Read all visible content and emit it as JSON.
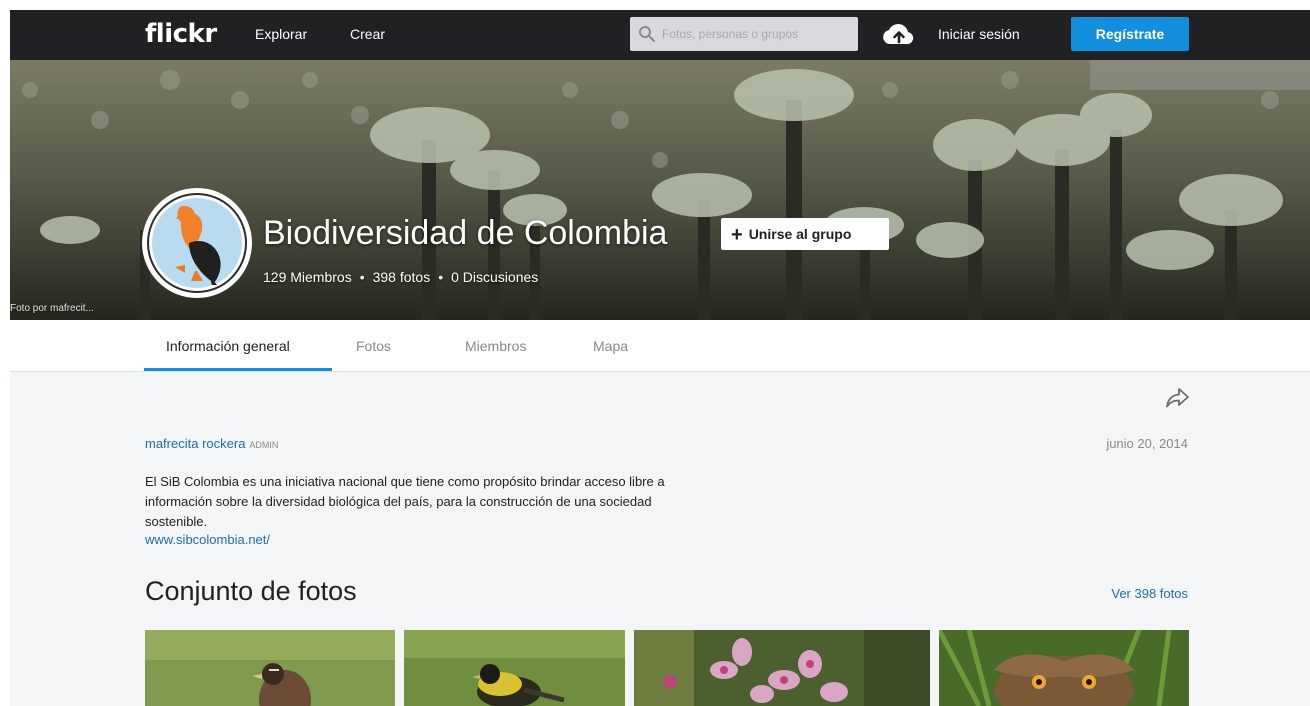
{
  "topbar": {
    "logo": "flickr",
    "nav": [
      "Explorar",
      "Crear"
    ],
    "search_placeholder": "Fotos, personas o grupos",
    "signin": "Iniciar sesión",
    "signup": "Regístrate",
    "icons": [
      "search-icon",
      "cloud-upload-icon"
    ]
  },
  "hero": {
    "credit": "Foto por mafrecit...",
    "title": "Biodiversidad de Colombia",
    "join_button": "Unirse al grupo",
    "stats": {
      "members": "129 Miembros",
      "photos": "398 fotos",
      "discussions": "0 Discusiones",
      "separator": "•"
    }
  },
  "tabs": [
    {
      "label": "Información general",
      "active": true
    },
    {
      "label": "Fotos",
      "active": false
    },
    {
      "label": "Miembros",
      "active": false
    },
    {
      "label": "Mapa",
      "active": false
    }
  ],
  "overview": {
    "admin_name": "mafrecita rockera",
    "admin_badge": "ADMIN",
    "date": "junio 20, 2014",
    "description": "El SiB Colombia es una iniciativa nacional que tiene como propósito brindar acceso libre a información sobre la diversidad biológica del país, para la construcción de una sociedad sostenible.",
    "link": "www.sibcolombia.net/"
  },
  "photosets": {
    "title": "Conjunto de fotos",
    "view_all": "Ver 398 fotos"
  },
  "colors": {
    "topbar": "#212124",
    "accent": "#128fdc",
    "link": "#1f6fa8",
    "page_bg": "#f3f5f6"
  }
}
